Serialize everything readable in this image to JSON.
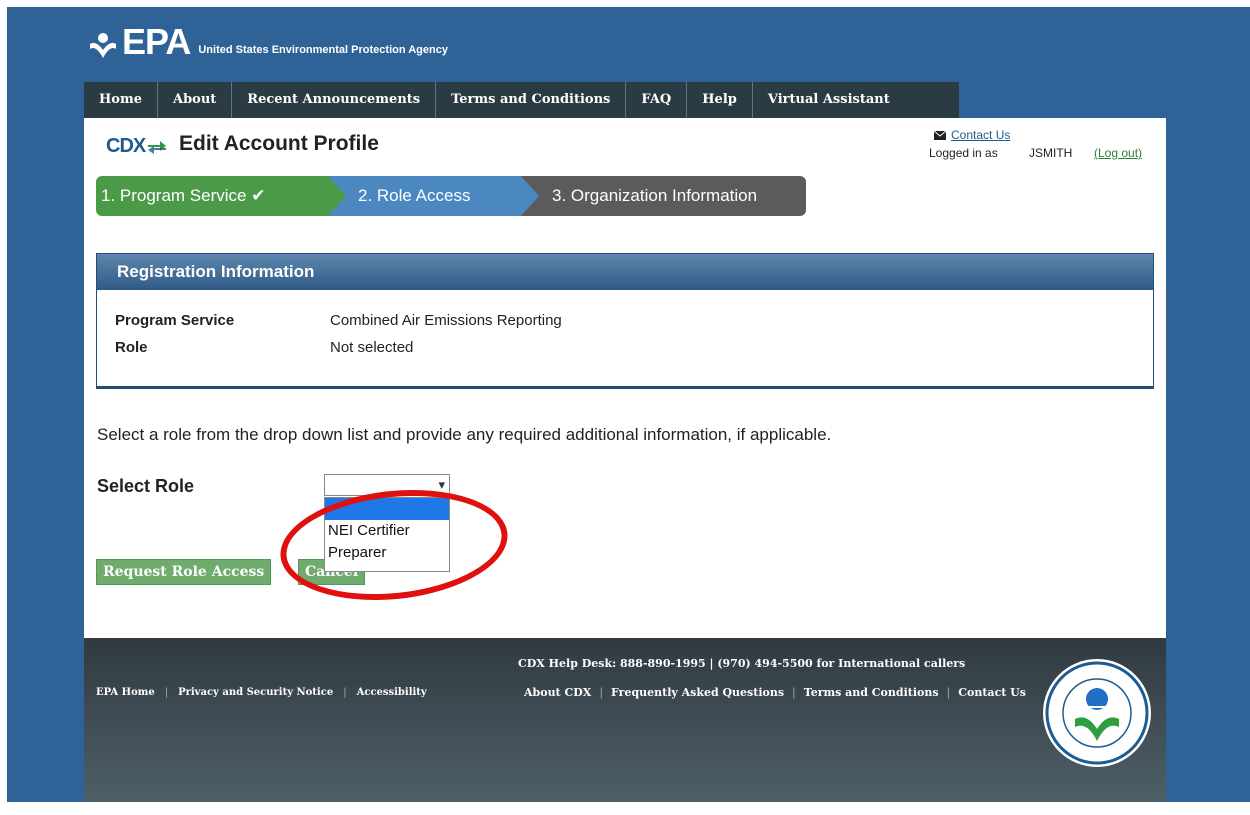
{
  "header": {
    "logo_text": "EPA",
    "agency_name": "United States Environmental Protection Agency"
  },
  "nav": {
    "items": [
      {
        "label": "Home"
      },
      {
        "label": "About"
      },
      {
        "label": "Recent Announcements"
      },
      {
        "label": "Terms and Conditions"
      },
      {
        "label": "FAQ"
      },
      {
        "label": "Help"
      },
      {
        "label": "Virtual Assistant"
      }
    ]
  },
  "account": {
    "contact_label": "Contact Us",
    "logged_in_label": "Logged in as",
    "username": "JSMITH",
    "logout_label": "(Log out)"
  },
  "page": {
    "cdx_logo": "CDX",
    "title": "Edit Account Profile"
  },
  "steps": [
    {
      "label": "1. Program Service ✔",
      "state": "complete",
      "color": "#4a9a48"
    },
    {
      "label": "2. Role Access",
      "state": "current",
      "color": "#4a88bf"
    },
    {
      "label": "3. Organization Information",
      "state": "pending",
      "color": "#5b5b5b"
    }
  ],
  "registration": {
    "heading": "Registration Information",
    "rows": [
      {
        "label": "Program Service",
        "value": "Combined Air Emissions Reporting"
      },
      {
        "label": "Role",
        "value": "Not selected"
      }
    ]
  },
  "form": {
    "instruction": "Select a role from the drop down list and provide any required additional information, if applicable.",
    "select_label": "Select Role",
    "selected_value": "",
    "options": [
      "",
      "NEI Certifier",
      "Preparer"
    ]
  },
  "buttons": {
    "request": "Request Role Access",
    "cancel": "Cancel"
  },
  "footer": {
    "left_links": [
      "EPA Home",
      "Privacy and Security Notice",
      "Accessibility"
    ],
    "helpdesk": "CDX Help Desk: 888-890-1995 | (970) 494-5500 for International callers",
    "right_links": [
      "About CDX",
      "Frequently Asked Questions",
      "Terms and Conditions",
      "Contact Us"
    ]
  },
  "colors": {
    "page_bg": "#2f6397",
    "nav_bg": "#2b3b44",
    "accent_blue": "#1f5b8f",
    "button_green": "#6fab6d",
    "annotation_red": "#e01010"
  }
}
